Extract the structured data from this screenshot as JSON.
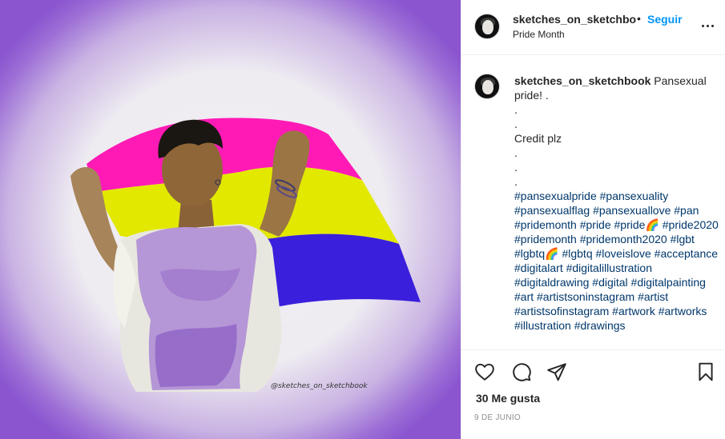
{
  "post": {
    "image": {
      "alt": "Illustration of a person holding a pansexual pride flag",
      "watermark": "@sketches_on_sketchbook",
      "flag_colors": {
        "pink": "#ff1ab5",
        "yellow": "#e2e800",
        "blue": "#3a1fdc"
      }
    },
    "header": {
      "username": "sketches_on_sketchbo",
      "separator": "•",
      "follow_label": "Seguir",
      "location": "Pride Month",
      "more_icon": "more-options-icon"
    },
    "caption": {
      "username": "sketches_on_sketchbook",
      "text": " Pansexual pride! .\n.\n.\nCredit plz\n.\n.\n.\n",
      "hashtags": "#pansexualpride #pansexuality #pansexualflag #pansexuallove #pan #pridemonth #pride #pride🌈 #pride2020 #pridemonth #pridemonth2020 #lgbt #lgbtq🌈 #lgbtq #loveislove #acceptance #digitalart #digitalillustration #digitaldrawing #digital #digitalpainting #art #artistsoninstagram #artist #artistsofinstagram #artwork #artworks #illustration #drawings"
    },
    "actions": {
      "like_icon": "heart-icon",
      "comment_icon": "comment-icon",
      "share_icon": "share-icon",
      "save_icon": "bookmark-icon"
    },
    "likes": "30 Me gusta",
    "date": "9 DE JUNIO"
  },
  "colors": {
    "link": "#0095f6",
    "hashtag": "#00376b",
    "text": "#262626",
    "muted": "#8e8e8e"
  }
}
